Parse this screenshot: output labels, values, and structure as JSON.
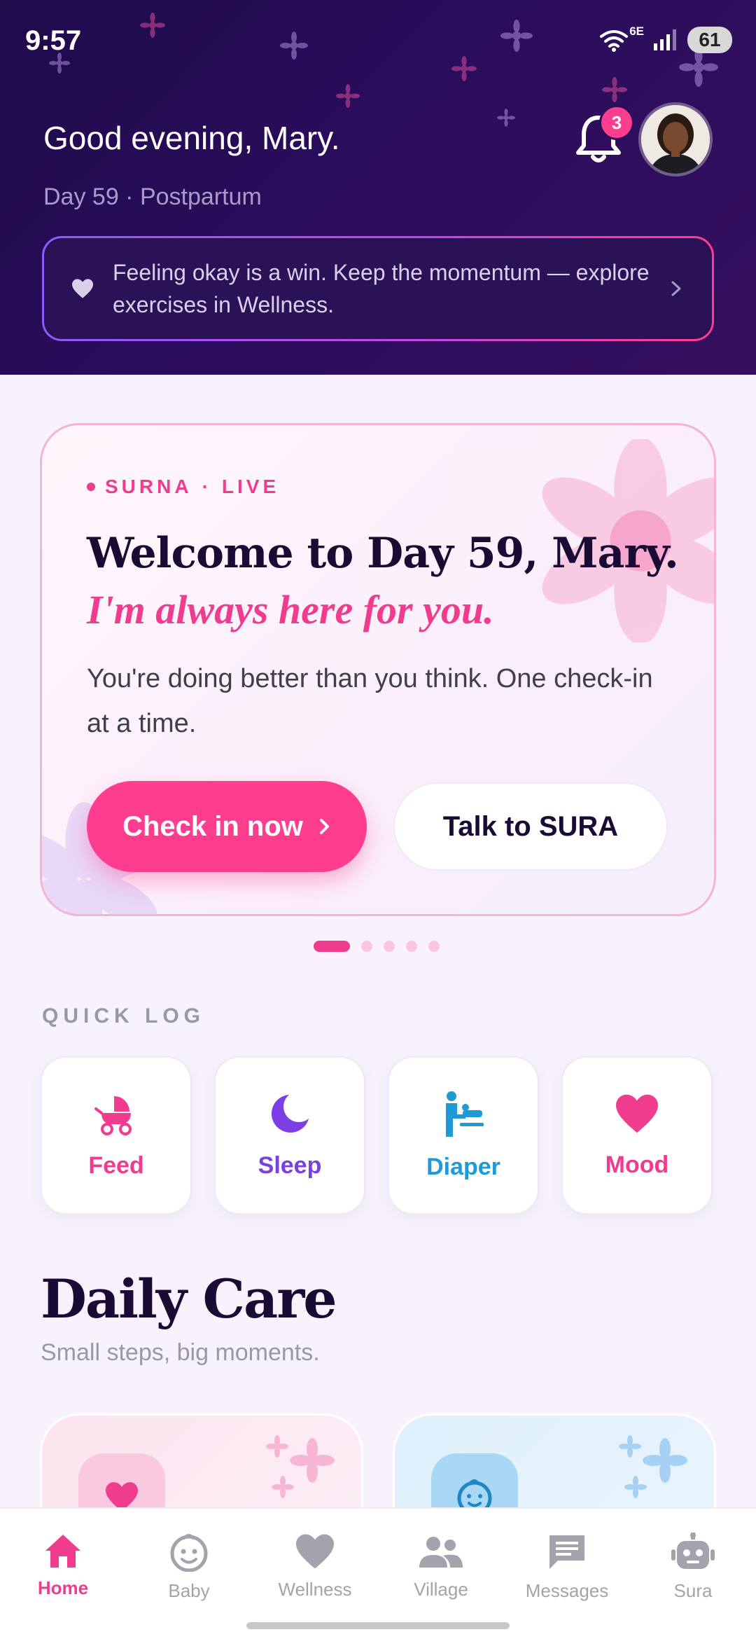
{
  "status_bar": {
    "time": "9:57",
    "network": "6E",
    "battery": "61"
  },
  "header": {
    "greeting": "Good evening, Mary.",
    "day_label": "Day 59 · Postpartum",
    "notification_count": "3",
    "banner_text": "Feeling okay is a win. Keep the momentum — explore exercises in Wellness."
  },
  "hero": {
    "live_brand": "SURNA",
    "live_sep": "·",
    "live_status": "LIVE",
    "title": "Welcome to Day 59, Mary.",
    "subtitle": "I'm always here for you.",
    "body": "You're doing better than you think. One check-in at a time.",
    "primary_button": "Check in now",
    "secondary_button": "Talk to SURA",
    "carousel_pages": 5,
    "carousel_active": 1
  },
  "quick_log": {
    "title": "QUICK LOG",
    "items": [
      {
        "label": "Feed",
        "icon": "stroller-icon",
        "color": "#f03c8f"
      },
      {
        "label": "Sleep",
        "icon": "moon-icon",
        "color": "#7b3fe4"
      },
      {
        "label": "Diaper",
        "icon": "baby-changing-icon",
        "color": "#1f9ad6"
      },
      {
        "label": "Mood",
        "icon": "heart-icon",
        "color": "#f03c8f"
      }
    ]
  },
  "daily_care": {
    "title": "Daily Care",
    "subtitle": "Small steps, big moments."
  },
  "bottom_nav": {
    "items": [
      {
        "label": "Home",
        "icon": "home-icon"
      },
      {
        "label": "Baby",
        "icon": "baby-face-icon"
      },
      {
        "label": "Wellness",
        "icon": "heart-icon"
      },
      {
        "label": "Village",
        "icon": "people-icon"
      },
      {
        "label": "Messages",
        "icon": "chat-icon"
      },
      {
        "label": "Sura",
        "icon": "robot-icon"
      }
    ],
    "active": "Home"
  },
  "colors": {
    "accent": "#f03c8f",
    "header_bg": "#2a0d5c",
    "sleep": "#7b3fe4",
    "diaper": "#1f9ad6"
  }
}
